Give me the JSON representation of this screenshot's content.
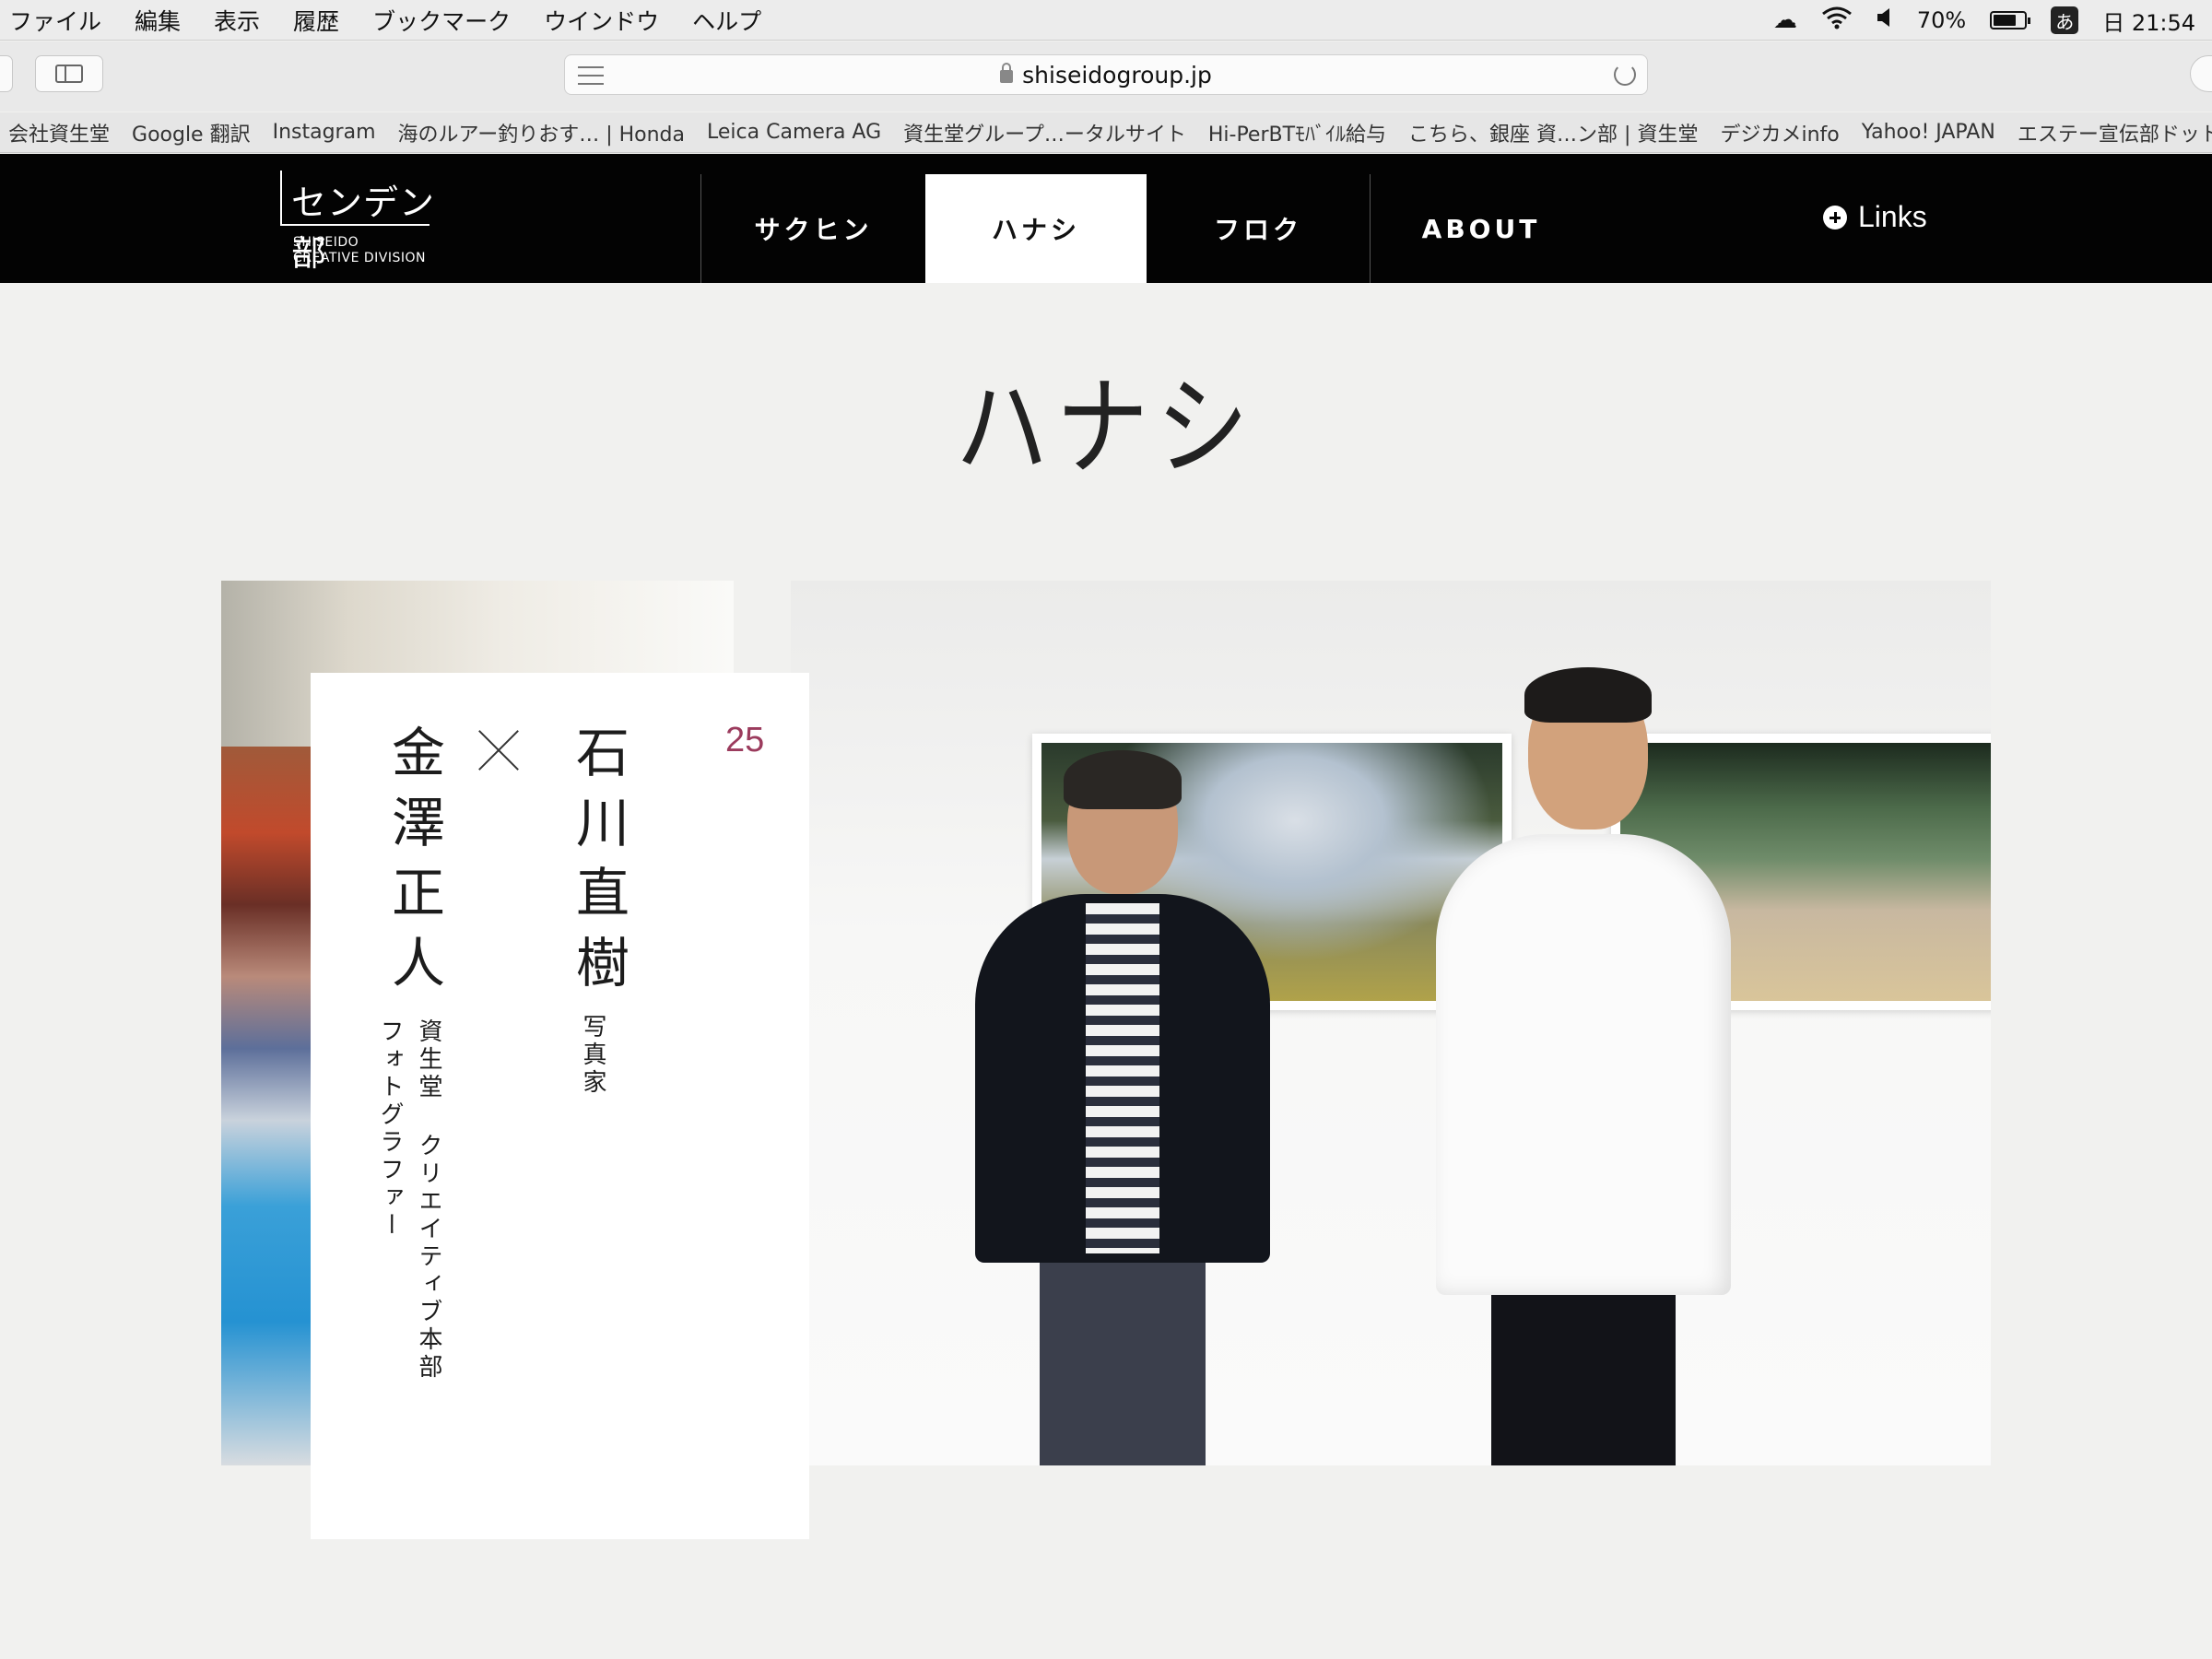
{
  "menubar": {
    "items": [
      "ファイル",
      "編集",
      "表示",
      "履歴",
      "ブックマーク",
      "ウインドウ",
      "ヘルプ"
    ],
    "battery_percent": "70%",
    "ime": "あ",
    "clock": "日 21:54"
  },
  "browser": {
    "url": "shiseidogroup.jp",
    "bookmarks": [
      "会社資生堂",
      "Google 翻訳",
      "Instagram",
      "海のルアー釣りおす… | Honda",
      "Leica Camera AG",
      "資生堂グループ…ータルサイト",
      "Hi-PerBTﾓﾊﾞｲﾙ給与",
      "こちら、銀座 資…ン部 | 資生堂",
      "デジカメinfo",
      "Yahoo! JAPAN",
      "エステー宣伝部ドットコム"
    ]
  },
  "site": {
    "logo_title": "センデン部",
    "logo_sub1": "SHISEIDO",
    "logo_sub2": "CREATIVE DIVISION",
    "nav": [
      "サクヒン",
      "ハナシ",
      "フロク",
      "ABOUT"
    ],
    "active_nav": "ハナシ",
    "links_label": "Links"
  },
  "page": {
    "title": "ハナシ"
  },
  "card": {
    "number": "25",
    "guest_name": "石川直樹",
    "guest_role": "写真家",
    "host_name": "金澤正人",
    "host_role_line1": "資生堂 クリエイティブ本部",
    "host_role_line2": "フォトグラファー"
  },
  "colors": {
    "accent_number": "#9b3b5d",
    "nav_bg": "#030303",
    "page_bg": "#f1f1ef"
  }
}
